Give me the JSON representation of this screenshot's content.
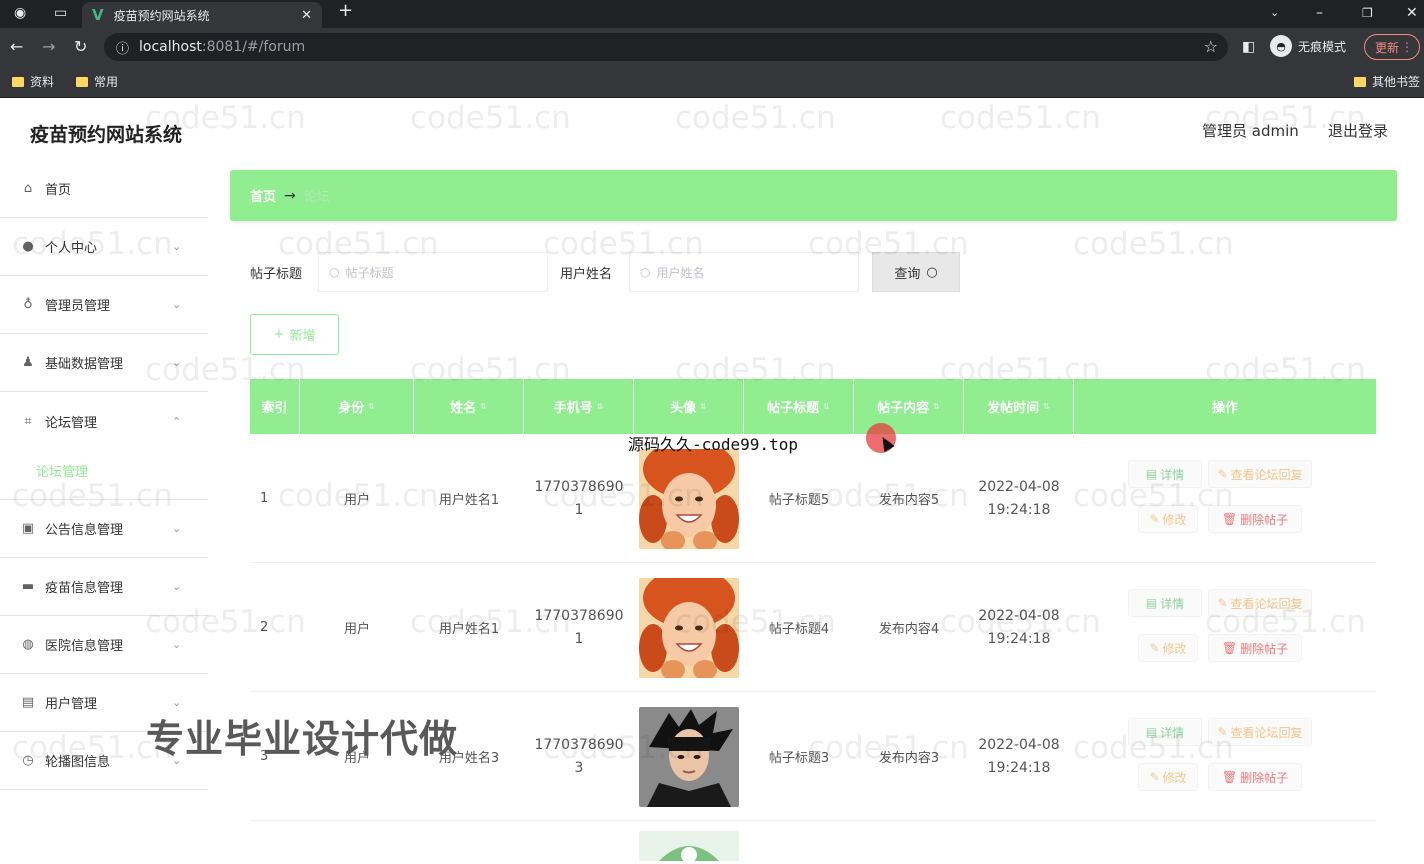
{
  "browser": {
    "tab_title": "疫苗预约网站系统",
    "tab_logo": "V",
    "url_host": "localhost",
    "url_path": ":8081/#/forum",
    "incognito_label": "无痕模式",
    "update_label": "更新",
    "bookmarks": [
      "资料",
      "常用"
    ],
    "other_bookmarks": "其他书签"
  },
  "header": {
    "brand": "疫苗预约网站系统",
    "admin_label": "管理员 admin",
    "logout": "退出登录"
  },
  "sidebar": {
    "items": [
      {
        "label": "首页",
        "icon": "home-icon"
      },
      {
        "label": "个人中心",
        "icon": "user-icon"
      },
      {
        "label": "管理员管理",
        "icon": "mic-icon"
      },
      {
        "label": "基础数据管理",
        "icon": "person-icon"
      },
      {
        "label": "论坛管理",
        "icon": "crop-icon"
      },
      {
        "label": "论坛管理",
        "icon": ""
      },
      {
        "label": "公告信息管理",
        "icon": "chart-icon"
      },
      {
        "label": "疫苗信息管理",
        "icon": "monitor-icon"
      },
      {
        "label": "医院信息管理",
        "icon": "globe-icon"
      },
      {
        "label": "用户管理",
        "icon": "clipboard-icon"
      },
      {
        "label": "轮播图信息",
        "icon": "clock-icon"
      }
    ]
  },
  "breadcrumb": {
    "home": "首页",
    "arrow": "→",
    "current": "论坛"
  },
  "search": {
    "title_label": "帖子标题",
    "title_placeholder": "帖子标题",
    "user_label": "用户姓名",
    "user_placeholder": "用户姓名",
    "query_label": "查询"
  },
  "actions": {
    "add_label": "新增"
  },
  "table": {
    "columns": [
      "索引",
      "身份",
      "姓名",
      "手机号",
      "头像",
      "帖子标题",
      "帖子内容",
      "发帖时间",
      "操作"
    ],
    "rows": [
      {
        "index": "1",
        "role": "用户",
        "name": "用户姓名1",
        "phone_a": "1770378690",
        "phone_b": "1",
        "title": "帖子标题5",
        "content": "发布内容5",
        "date": "2022-04-08",
        "time": "19:24:18",
        "avatar": "girl-orange-hair"
      },
      {
        "index": "2",
        "role": "用户",
        "name": "用户姓名1",
        "phone_a": "1770378690",
        "phone_b": "1",
        "title": "帖子标题4",
        "content": "发布内容4",
        "date": "2022-04-08",
        "time": "19:24:18",
        "avatar": "girl-orange-hair"
      },
      {
        "index": "3",
        "role": "用户",
        "name": "用户姓名3",
        "phone_a": "1770378690",
        "phone_b": "3",
        "title": "帖子标题3",
        "content": "发布内容3",
        "date": "2022-04-08",
        "time": "19:24:18",
        "avatar": "boy-dark-hair"
      }
    ],
    "ops": {
      "detail": "详情",
      "reply": "查看论坛回复",
      "edit": "修改",
      "delete": "删除帖子"
    }
  },
  "overlays": {
    "watermark": "code51.cn",
    "code_text": "源码久久-code99.top",
    "promo_text": "专业毕业设计代做"
  },
  "colors": {
    "accent": "#90ee90",
    "delete": "#f07a7a",
    "warning": "#f5c48a"
  }
}
